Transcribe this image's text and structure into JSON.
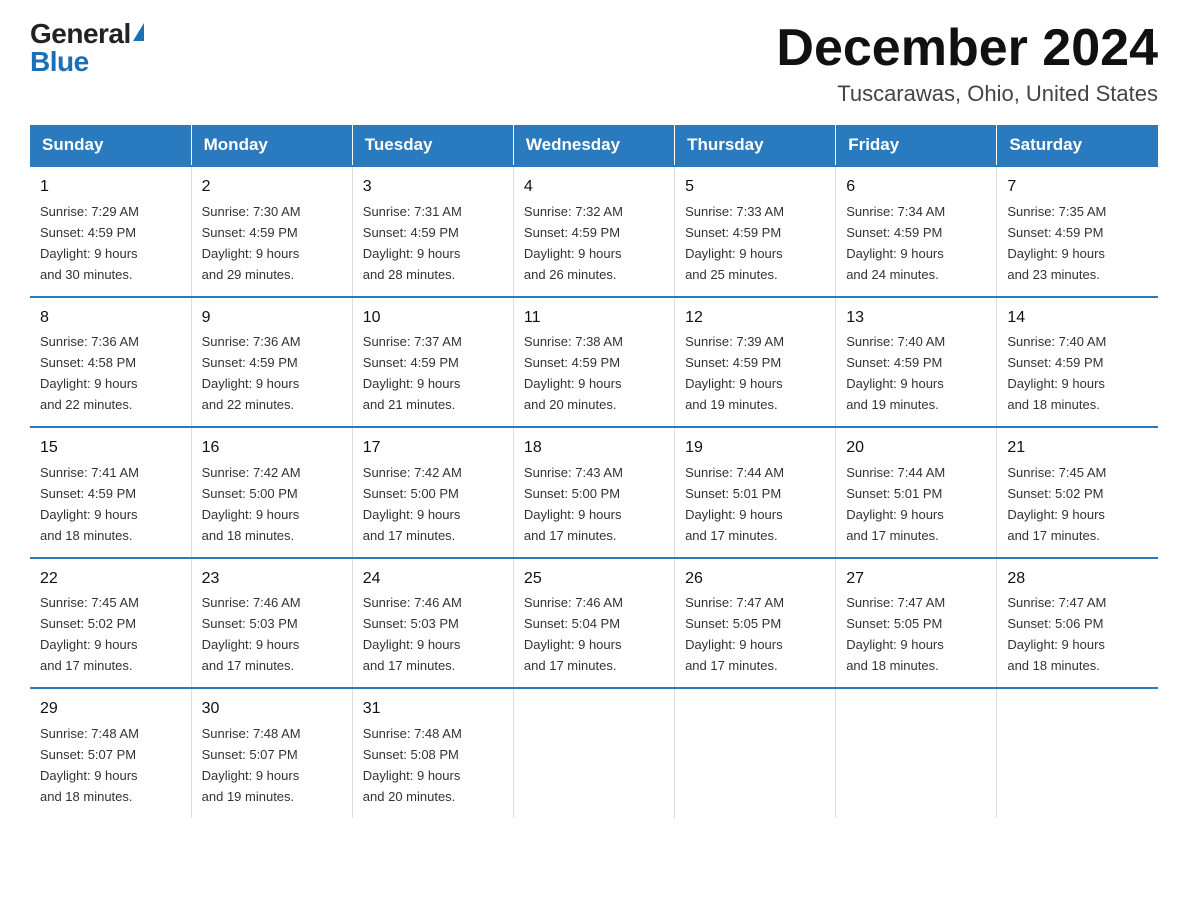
{
  "header": {
    "logo_general": "General",
    "logo_blue": "Blue",
    "month_title": "December 2024",
    "location": "Tuscarawas, Ohio, United States"
  },
  "days_of_week": [
    "Sunday",
    "Monday",
    "Tuesday",
    "Wednesday",
    "Thursday",
    "Friday",
    "Saturday"
  ],
  "weeks": [
    [
      {
        "day": "1",
        "sunrise": "7:29 AM",
        "sunset": "4:59 PM",
        "daylight": "9 hours and 30 minutes."
      },
      {
        "day": "2",
        "sunrise": "7:30 AM",
        "sunset": "4:59 PM",
        "daylight": "9 hours and 29 minutes."
      },
      {
        "day": "3",
        "sunrise": "7:31 AM",
        "sunset": "4:59 PM",
        "daylight": "9 hours and 28 minutes."
      },
      {
        "day": "4",
        "sunrise": "7:32 AM",
        "sunset": "4:59 PM",
        "daylight": "9 hours and 26 minutes."
      },
      {
        "day": "5",
        "sunrise": "7:33 AM",
        "sunset": "4:59 PM",
        "daylight": "9 hours and 25 minutes."
      },
      {
        "day": "6",
        "sunrise": "7:34 AM",
        "sunset": "4:59 PM",
        "daylight": "9 hours and 24 minutes."
      },
      {
        "day": "7",
        "sunrise": "7:35 AM",
        "sunset": "4:59 PM",
        "daylight": "9 hours and 23 minutes."
      }
    ],
    [
      {
        "day": "8",
        "sunrise": "7:36 AM",
        "sunset": "4:58 PM",
        "daylight": "9 hours and 22 minutes."
      },
      {
        "day": "9",
        "sunrise": "7:36 AM",
        "sunset": "4:59 PM",
        "daylight": "9 hours and 22 minutes."
      },
      {
        "day": "10",
        "sunrise": "7:37 AM",
        "sunset": "4:59 PM",
        "daylight": "9 hours and 21 minutes."
      },
      {
        "day": "11",
        "sunrise": "7:38 AM",
        "sunset": "4:59 PM",
        "daylight": "9 hours and 20 minutes."
      },
      {
        "day": "12",
        "sunrise": "7:39 AM",
        "sunset": "4:59 PM",
        "daylight": "9 hours and 19 minutes."
      },
      {
        "day": "13",
        "sunrise": "7:40 AM",
        "sunset": "4:59 PM",
        "daylight": "9 hours and 19 minutes."
      },
      {
        "day": "14",
        "sunrise": "7:40 AM",
        "sunset": "4:59 PM",
        "daylight": "9 hours and 18 minutes."
      }
    ],
    [
      {
        "day": "15",
        "sunrise": "7:41 AM",
        "sunset": "4:59 PM",
        "daylight": "9 hours and 18 minutes."
      },
      {
        "day": "16",
        "sunrise": "7:42 AM",
        "sunset": "5:00 PM",
        "daylight": "9 hours and 18 minutes."
      },
      {
        "day": "17",
        "sunrise": "7:42 AM",
        "sunset": "5:00 PM",
        "daylight": "9 hours and 17 minutes."
      },
      {
        "day": "18",
        "sunrise": "7:43 AM",
        "sunset": "5:00 PM",
        "daylight": "9 hours and 17 minutes."
      },
      {
        "day": "19",
        "sunrise": "7:44 AM",
        "sunset": "5:01 PM",
        "daylight": "9 hours and 17 minutes."
      },
      {
        "day": "20",
        "sunrise": "7:44 AM",
        "sunset": "5:01 PM",
        "daylight": "9 hours and 17 minutes."
      },
      {
        "day": "21",
        "sunrise": "7:45 AM",
        "sunset": "5:02 PM",
        "daylight": "9 hours and 17 minutes."
      }
    ],
    [
      {
        "day": "22",
        "sunrise": "7:45 AM",
        "sunset": "5:02 PM",
        "daylight": "9 hours and 17 minutes."
      },
      {
        "day": "23",
        "sunrise": "7:46 AM",
        "sunset": "5:03 PM",
        "daylight": "9 hours and 17 minutes."
      },
      {
        "day": "24",
        "sunrise": "7:46 AM",
        "sunset": "5:03 PM",
        "daylight": "9 hours and 17 minutes."
      },
      {
        "day": "25",
        "sunrise": "7:46 AM",
        "sunset": "5:04 PM",
        "daylight": "9 hours and 17 minutes."
      },
      {
        "day": "26",
        "sunrise": "7:47 AM",
        "sunset": "5:05 PM",
        "daylight": "9 hours and 17 minutes."
      },
      {
        "day": "27",
        "sunrise": "7:47 AM",
        "sunset": "5:05 PM",
        "daylight": "9 hours and 18 minutes."
      },
      {
        "day": "28",
        "sunrise": "7:47 AM",
        "sunset": "5:06 PM",
        "daylight": "9 hours and 18 minutes."
      }
    ],
    [
      {
        "day": "29",
        "sunrise": "7:48 AM",
        "sunset": "5:07 PM",
        "daylight": "9 hours and 18 minutes."
      },
      {
        "day": "30",
        "sunrise": "7:48 AM",
        "sunset": "5:07 PM",
        "daylight": "9 hours and 19 minutes."
      },
      {
        "day": "31",
        "sunrise": "7:48 AM",
        "sunset": "5:08 PM",
        "daylight": "9 hours and 20 minutes."
      },
      null,
      null,
      null,
      null
    ]
  ],
  "labels": {
    "sunrise": "Sunrise:",
    "sunset": "Sunset:",
    "daylight": "Daylight:"
  }
}
